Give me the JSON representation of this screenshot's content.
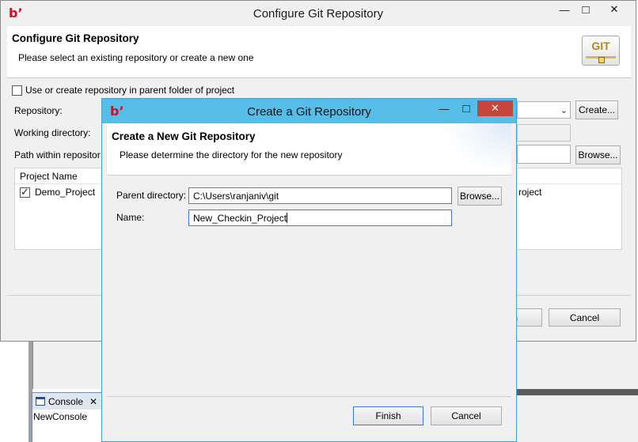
{
  "outer_window": {
    "title": "Configure Git Repository",
    "controls": {
      "minimize": "—",
      "maximize": "□",
      "close": "✕"
    },
    "header_title": "Configure Git Repository",
    "header_desc": "Please select an existing repository or create a new one",
    "git_badge": "GIT",
    "use_parent_label": "Use or create repository in parent folder of project",
    "repository_label": "Repository:",
    "working_dir_label": "Working directory:",
    "path_within_label": "Path within repositor",
    "create_button": "Create...",
    "browse_button": "Browse...",
    "table": {
      "header": "Project Name",
      "rows": [
        {
          "name": "Demo_Project",
          "path": "roject",
          "checked": true
        }
      ]
    },
    "finish_button_partial": "h",
    "cancel_button": "Cancel"
  },
  "inner_dialog": {
    "title": "Create a Git Repository",
    "controls": {
      "minimize": "—",
      "maximize": "□",
      "close": "✕"
    },
    "header_title": "Create a New Git Repository",
    "header_desc": "Please determine the directory for the new repository",
    "parent_dir_label": "Parent directory:",
    "parent_dir_value": "C:\\Users\\ranjaniv\\git",
    "browse_button": "Browse...",
    "name_label": "Name:",
    "name_value": "New_Checkin_Project",
    "finish_button": "Finish",
    "cancel_button": "Cancel"
  },
  "background_ide": {
    "console_tab": "Console",
    "console_close": "✕",
    "console_text": "NewConsole"
  },
  "colors": {
    "dialog_title_active": "#55bde6",
    "logo_red": "#c8102e",
    "window_bg": "#f0f0f0"
  }
}
